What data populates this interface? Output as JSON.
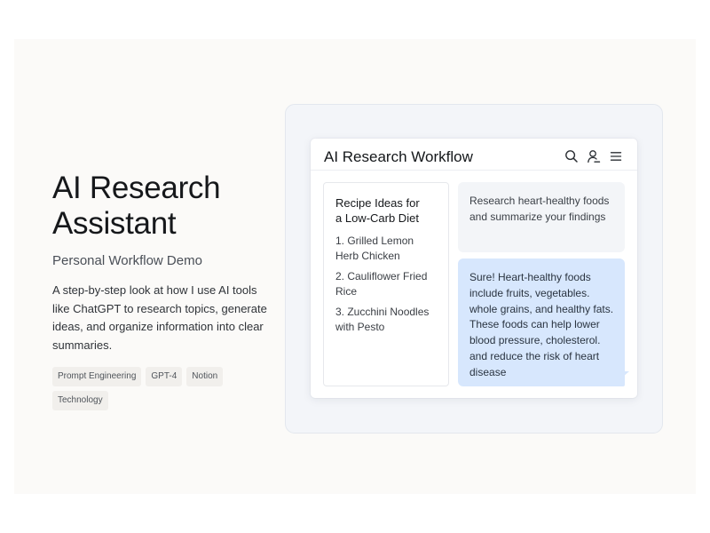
{
  "hero": {
    "title_line1": "AI Research",
    "title_line2": "Assistant",
    "subtitle": "Personal Workflow Demo",
    "description": "A step-by-step look at how I use AI tools like ChatGPT to research topics, generate ideas, and organize information into clear summaries.",
    "tags": [
      "Prompt Engineering",
      "GPT-4",
      "Notion",
      "Technology"
    ]
  },
  "app": {
    "title": "AI Research Workflow",
    "header_icons": [
      "search-icon",
      "user-icon",
      "menu-icon"
    ],
    "recipe_card": {
      "title_line1": "Recipe Ideas for",
      "title_line2": "a Low-Carb Diet",
      "items": [
        "1. Grilled Lemon Herb Chicken",
        "2. Cauliflower Fried Rice",
        "3. Zucchini Noodles with Pesto"
      ]
    },
    "chat": {
      "user_message": "Research heart-healthy foods and summarize your findings",
      "ai_message": "Sure! Heart-healthy foods include fruits, vegetables. whole grains, and healthy fats. These foods can help lower blood pressure, cholesterol. and reduce the risk of heart disease"
    }
  },
  "colors": {
    "page_background": "#fbfaf8",
    "panel_background": "#f3f5f9",
    "ai_bubble": "#d7e7fd",
    "user_bubble": "#f3f5f8",
    "tag_background": "#f1efec"
  }
}
